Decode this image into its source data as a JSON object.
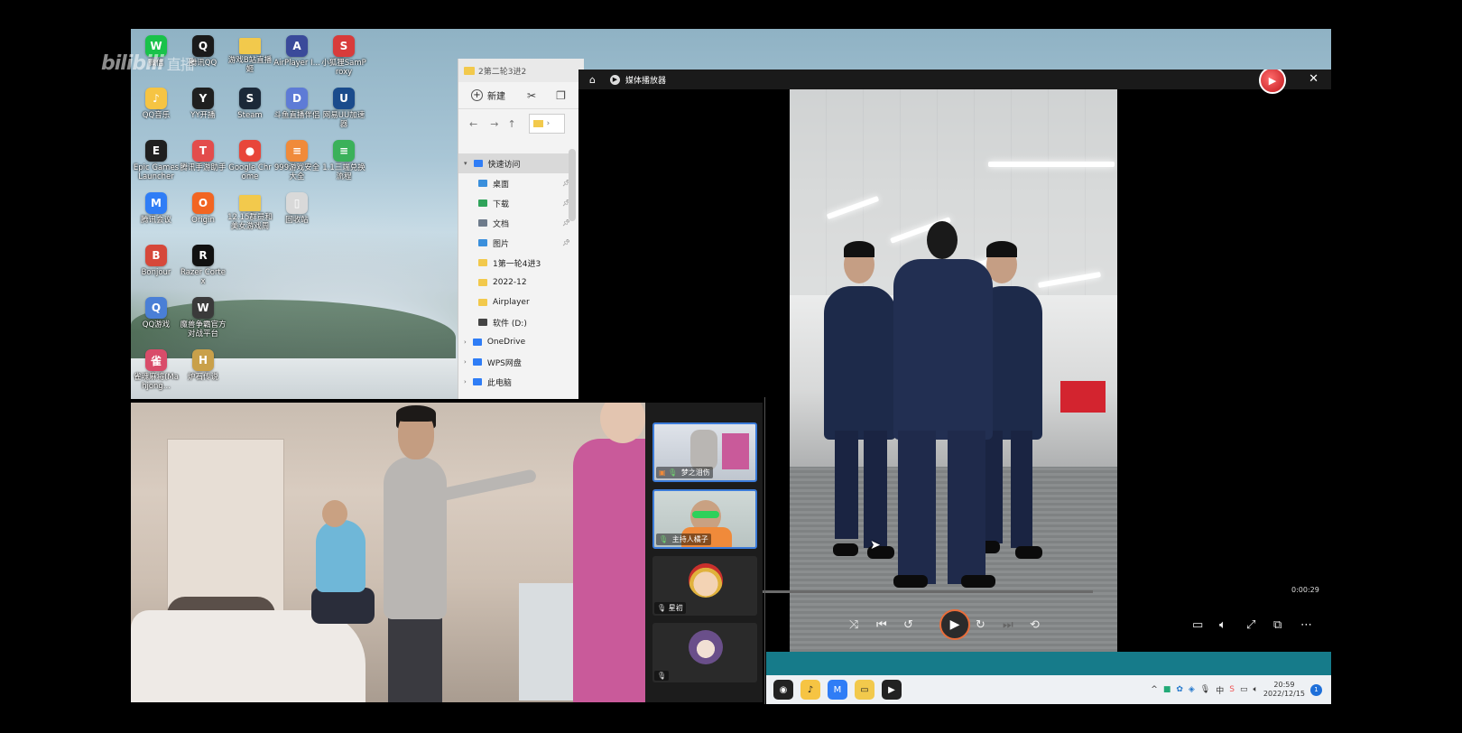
{
  "watermark": {
    "brand": "bilibili",
    "suffix": "直播"
  },
  "desktop_icons": [
    {
      "label": "微信",
      "icon": "wechat-icon",
      "color": "#19c24a",
      "glyph": "W"
    },
    {
      "label": "腾讯QQ",
      "icon": "qq-icon",
      "color": "#1a1a1a",
      "glyph": "Q"
    },
    {
      "label": "游戏B站直播姬",
      "icon": "folder-icon",
      "color": "#f2c94c",
      "glyph": ""
    },
    {
      "label": "AirPlayer I...",
      "icon": "airplayer-icon",
      "color": "#3a4a9a",
      "glyph": "A"
    },
    {
      "label": "小狐狸SamProxy",
      "icon": "sam-icon",
      "color": "#d83b3b",
      "glyph": "S"
    },
    {
      "label": "QQ音乐",
      "icon": "qqmusic-icon",
      "color": "#f6c443",
      "glyph": "♪"
    },
    {
      "label": "YY开播",
      "icon": "yy-icon",
      "color": "#1f1f1f",
      "glyph": "Y"
    },
    {
      "label": "Steam",
      "icon": "steam-icon",
      "color": "#1b2838",
      "glyph": "S"
    },
    {
      "label": "斗鱼直播伴侣",
      "icon": "douyu-icon",
      "color": "#5e7bd6",
      "glyph": "D"
    },
    {
      "label": "网易UU加速器",
      "icon": "uu-icon",
      "color": "#1a4b8c",
      "glyph": "U"
    },
    {
      "label": "Epic Games Launcher",
      "icon": "epic-icon",
      "color": "#1f1f1f",
      "glyph": "E"
    },
    {
      "label": "腾讯手游助手",
      "icon": "tencent-assist-icon",
      "color": "#e34c4c",
      "glyph": "T"
    },
    {
      "label": "Google Chrome",
      "icon": "chrome-icon",
      "color": "#e8463a",
      "glyph": "●"
    },
    {
      "label": "999游戏安全大全",
      "icon": "doc-icon",
      "color": "#f08a3a",
      "glyph": "≡"
    },
    {
      "label": "1.1三端兑换流程",
      "icon": "sheet-icon",
      "color": "#3bb15a",
      "glyph": "≡"
    },
    {
      "label": "腾讯会议",
      "icon": "meeting-icon",
      "color": "#2f7df6",
      "glyph": "M"
    },
    {
      "label": "Origin",
      "icon": "origin-icon",
      "color": "#f26522",
      "glyph": "O"
    },
    {
      "label": "12.15群员和美女游戏周",
      "icon": "folder-icon",
      "color": "#f2c94c",
      "glyph": ""
    },
    {
      "label": "回收站",
      "icon": "recycle-bin-icon",
      "color": "#d9d9d9",
      "glyph": "▯"
    },
    {
      "label": "",
      "icon": "",
      "color": "",
      "glyph": ""
    },
    {
      "label": "Bonjour",
      "icon": "bonjour-icon",
      "color": "#d6483a",
      "glyph": "B"
    },
    {
      "label": "Razer Cortex",
      "icon": "razer-icon",
      "color": "#111",
      "glyph": "R"
    },
    {
      "label": "",
      "icon": "",
      "color": "",
      "glyph": ""
    },
    {
      "label": "",
      "icon": "",
      "color": "",
      "glyph": ""
    },
    {
      "label": "",
      "icon": "",
      "color": "",
      "glyph": ""
    },
    {
      "label": "QQ游戏",
      "icon": "qqgame-icon",
      "color": "#4a7fd6",
      "glyph": "Q"
    },
    {
      "label": "魔兽争霸官方对战平台",
      "icon": "warcraft-icon",
      "color": "#3a3a3a",
      "glyph": "W"
    },
    {
      "label": "",
      "icon": "",
      "color": "",
      "glyph": ""
    },
    {
      "label": "",
      "icon": "",
      "color": "",
      "glyph": ""
    },
    {
      "label": "",
      "icon": "",
      "color": "",
      "glyph": ""
    },
    {
      "label": "雀魂麻将(Mahjong...",
      "icon": "mahjong-icon",
      "color": "#d94c6a",
      "glyph": "雀"
    },
    {
      "label": "炉石传说",
      "icon": "hearthstone-icon",
      "color": "#c9a04a",
      "glyph": "H"
    }
  ],
  "explorer": {
    "title": "2第二轮3进2",
    "new_label": "新建",
    "address_sep": "›",
    "tree": [
      {
        "label": "快速访问",
        "type": "top",
        "icon_color": "#2f7df6",
        "pinned": false
      },
      {
        "label": "桌面",
        "type": "child",
        "icon_color": "#3a8fdc",
        "pinned": true
      },
      {
        "label": "下载",
        "type": "child",
        "icon_color": "#2fa35a",
        "pinned": true
      },
      {
        "label": "文档",
        "type": "child",
        "icon_color": "#6e7b8b",
        "pinned": true
      },
      {
        "label": "图片",
        "type": "child",
        "icon_color": "#3a8fdc",
        "pinned": true
      },
      {
        "label": "1第一轮4进3",
        "type": "child",
        "icon_color": "#f2c94c",
        "pinned": false
      },
      {
        "label": "2022-12",
        "type": "child",
        "icon_color": "#f2c94c",
        "pinned": false
      },
      {
        "label": "Airplayer",
        "type": "child",
        "icon_color": "#f2c94c",
        "pinned": false
      },
      {
        "label": "软件 (D:)",
        "type": "child",
        "icon_color": "#444",
        "pinned": false
      },
      {
        "label": "OneDrive",
        "type": "top",
        "icon_color": "#2f7df6",
        "pinned": false
      },
      {
        "label": "WPS网盘",
        "type": "top",
        "icon_color": "#2f7df6",
        "pinned": false
      },
      {
        "label": "此电脑",
        "type": "top",
        "icon_color": "#2f7df6",
        "pinned": false
      }
    ]
  },
  "player": {
    "title": "媒体播放器",
    "time": "0:00:29",
    "progress": 0.0
  },
  "taskbar": {
    "apps": [
      {
        "icon": "obs-icon",
        "color": "#222",
        "glyph": "◉"
      },
      {
        "icon": "qqmusic-icon",
        "color": "#f6c443",
        "glyph": "♪"
      },
      {
        "icon": "meeting-icon",
        "color": "#2f7df6",
        "glyph": "M"
      },
      {
        "icon": "file-explorer-icon",
        "color": "#f2c94c",
        "glyph": "▭"
      },
      {
        "icon": "media-player-icon",
        "color": "#222",
        "glyph": "▶"
      }
    ],
    "ime": "中",
    "time": "20:59",
    "date": "2022/12/15",
    "notifications": "1"
  },
  "participants": [
    {
      "name": "梦之泪伤",
      "mic": "on"
    },
    {
      "name": "主持人橘子",
      "mic": "on"
    },
    {
      "name": "星初",
      "mic": "muted"
    },
    {
      "name": "",
      "mic": "muted"
    }
  ]
}
